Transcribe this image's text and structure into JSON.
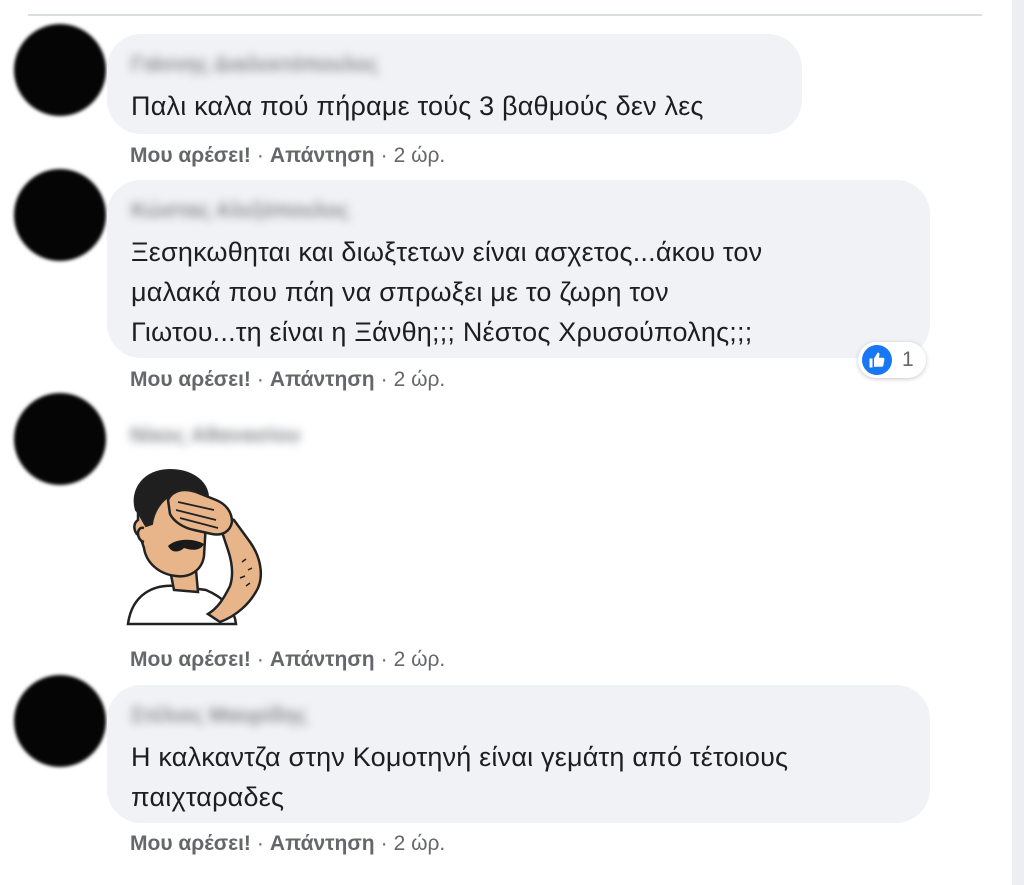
{
  "comments": [
    {
      "author": "Γιάννης Διαλεκτόπουλος",
      "text": [
        "Παλι καλα πού πήραμε τούς 3 βαθμούς δεν λες"
      ],
      "actions": {
        "like": "Μου αρέσει!",
        "reply": "Απάντηση",
        "time": "2 ώρ."
      }
    },
    {
      "author": "Κώστας Αλεξόπουλος",
      "text": [
        "Ξεσηκωθηται και διωξτετων είναι ασχετος...άκου τον",
        "μαλακά που πάη να σπρωξει με το ζωρη τον",
        "Γιωτου...τη είναι η Ξάνθη;;; Νέστος Χρυσούπολης;;;"
      ],
      "reactions": {
        "icon": "like-icon",
        "count": "1"
      },
      "actions": {
        "like": "Μου αρέσει!",
        "reply": "Απάντηση",
        "time": "2 ώρ."
      }
    },
    {
      "author": "Νίκος Αθανασίου",
      "sticker": "facepalm-sticker",
      "actions": {
        "like": "Μου αρέσει!",
        "reply": "Απάντηση",
        "time": "2 ώρ."
      }
    },
    {
      "author": "Στέλιος Μαυρίδης",
      "text": [
        "Η καλκαντζα στην Κομοτηνή είναι γεμάτη από τέτοιους",
        "παιχταραδες"
      ],
      "actions": {
        "like": "Μου αρέσει!",
        "reply": "Απάντηση",
        "time": "2 ώρ."
      }
    }
  ],
  "separator": "·",
  "colors": {
    "bubble": "#f0f2f5",
    "text": "#1c1e21",
    "meta": "#65676b",
    "like_blue": "#1877f2"
  }
}
